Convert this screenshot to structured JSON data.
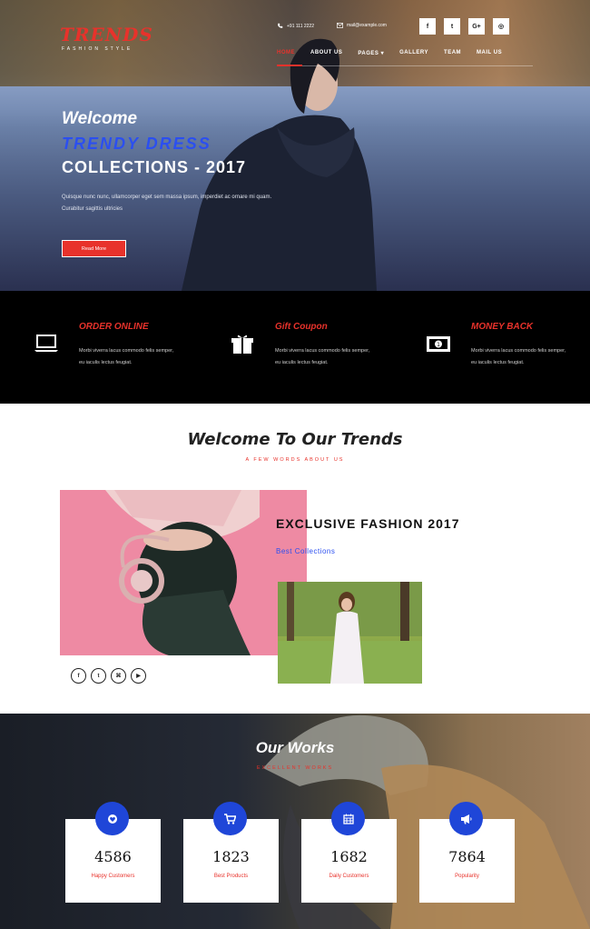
{
  "brand": {
    "name": "TRENDS",
    "tagline": "FASHION STYLE"
  },
  "contact": {
    "phone": "+91 111 2222",
    "email": "mail@example.com"
  },
  "social_top": [
    "f",
    "t",
    "G+",
    "◎"
  ],
  "nav": {
    "items": [
      {
        "label": "HOME",
        "active": true
      },
      {
        "label": "ABOUT US",
        "active": false
      },
      {
        "label": "PAGES ▾",
        "active": false
      },
      {
        "label": "GALLERY",
        "active": false
      },
      {
        "label": "TEAM",
        "active": false
      },
      {
        "label": "MAIL US",
        "active": false
      }
    ]
  },
  "hero": {
    "line1": "Welcome",
    "line2": "TRENDY DRESS",
    "line3": "COLLECTIONS - 2017",
    "description": "Quisque nunc nunc, ullamcorper eget sem massa ipsum, imperdiet ac ornare mi quam. Curabitur sagittis ultricies",
    "button": "Read More"
  },
  "features": [
    {
      "title": "ORDER ONLINE",
      "text": "Morbi viverra lacus commodo felis semper, eu iaculis lectus feugiat.",
      "icon": "laptop-icon"
    },
    {
      "title": "Gift Coupon",
      "text": "Morbi viverra lacus commodo felis semper, eu iaculis lectus feugiat.",
      "icon": "gift-icon"
    },
    {
      "title": "MONEY BACK",
      "text": "Morbi viverra lacus commodo felis semper, eu iaculis lectus feugiat.",
      "icon": "money-icon"
    }
  ],
  "welcome": {
    "title": "Welcome To Our Trends",
    "subtitle": "A FEW WORDS ABOUT US",
    "heading": "EXCLUSIVE FASHION 2017",
    "link": "Best Collections",
    "social": [
      "f",
      "t",
      "⌘",
      "▶"
    ]
  },
  "works": {
    "title": "Our Works",
    "subtitle": "EXCELLENT WORKS",
    "stats": [
      {
        "value": "4586",
        "label": "Happy Customers",
        "icon": "heart-icon"
      },
      {
        "value": "1823",
        "label": "Best Products",
        "icon": "cart-icon"
      },
      {
        "value": "1682",
        "label": "Daily Customers",
        "icon": "calendar-icon"
      },
      {
        "value": "7864",
        "label": "Popularity",
        "icon": "megaphone-icon"
      }
    ]
  },
  "colors": {
    "accent": "#e8322b",
    "blue": "#1f46d8",
    "dark": "#000000"
  }
}
